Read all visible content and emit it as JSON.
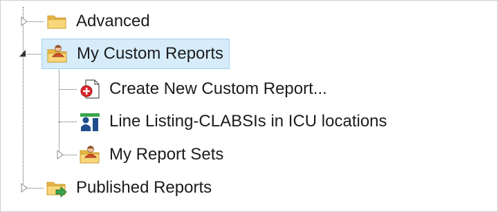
{
  "tree": {
    "nodes": [
      {
        "label": "Advanced",
        "icon": "folder-icon",
        "state": "collapsed"
      },
      {
        "label": "My Custom Reports",
        "icon": "user-folder-icon",
        "state": "expanded",
        "selected": true
      },
      {
        "label": "Create New Custom Report...",
        "icon": "new-report-icon",
        "state": "leaf"
      },
      {
        "label": "Line Listing-CLABSIs in ICU locations",
        "icon": "line-listing-icon",
        "state": "leaf"
      },
      {
        "label": "My Report Sets",
        "icon": "user-folder-icon",
        "state": "collapsed"
      },
      {
        "label": "Published Reports",
        "icon": "published-folder-icon",
        "state": "collapsed"
      }
    ],
    "colors": {
      "selection_bg": "#d6ecfa",
      "selection_border": "#9fd0ef",
      "folder": "#f3c75a",
      "new_report_red": "#d9262b",
      "listing_blue": "#1f4e8c",
      "listing_green": "#3aa54a"
    }
  }
}
